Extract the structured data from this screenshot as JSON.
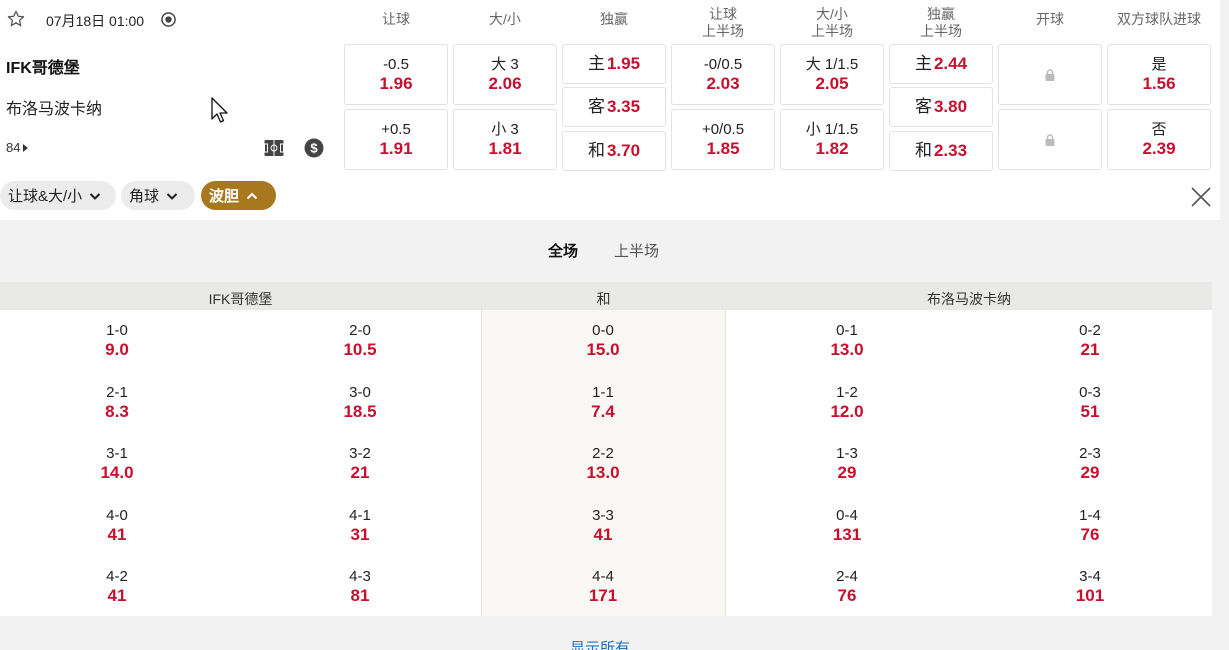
{
  "match": {
    "time": "07月18日 01:00",
    "home_team": "IFK哥德堡",
    "away_team": "布洛马波卡纳",
    "more_markets": "84"
  },
  "columns": [
    "让球",
    "大/小",
    "独赢",
    "让球\n上半场",
    "大/小\n上半场",
    "独赢\n上半场",
    "开球",
    "双方球队进球"
  ],
  "markets": {
    "handicap": [
      {
        "line": "-0.5",
        "odds": "1.96"
      },
      {
        "line": "+0.5",
        "odds": "1.91"
      }
    ],
    "over_under": [
      {
        "line": "大 3",
        "odds": "2.06"
      },
      {
        "line": "小 3",
        "odds": "1.81"
      }
    ],
    "moneyline": [
      {
        "label": "主",
        "odds": "1.95"
      },
      {
        "label": "客",
        "odds": "3.35"
      },
      {
        "label": "和",
        "odds": "3.70"
      }
    ],
    "handicap_1h": [
      {
        "line": "-0/0.5",
        "odds": "2.03"
      },
      {
        "line": "+0/0.5",
        "odds": "1.85"
      }
    ],
    "over_under_1h": [
      {
        "line": "大 1/1.5",
        "odds": "2.05"
      },
      {
        "line": "小 1/1.5",
        "odds": "1.82"
      }
    ],
    "moneyline_1h": [
      {
        "label": "主",
        "odds": "2.44"
      },
      {
        "label": "客",
        "odds": "3.80"
      },
      {
        "label": "和",
        "odds": "2.33"
      }
    ],
    "btts": [
      {
        "label": "是",
        "odds": "1.56"
      },
      {
        "label": "否",
        "odds": "2.39"
      }
    ]
  },
  "filters": [
    {
      "label": "让球&大/小",
      "active": false
    },
    {
      "label": "角球",
      "active": false
    },
    {
      "label": "波胆",
      "active": true
    }
  ],
  "period_tabs": [
    {
      "label": "全场",
      "active": true
    },
    {
      "label": "上半场",
      "active": false
    }
  ],
  "correct_score": {
    "headers": {
      "home": "IFK哥德堡",
      "draw": "和",
      "away": "布洛马波卡纳"
    },
    "home_col1": [
      [
        "1-0",
        "9.0"
      ],
      [
        "2-1",
        "8.3"
      ],
      [
        "3-1",
        "14.0"
      ],
      [
        "4-0",
        "41"
      ],
      [
        "4-2",
        "41"
      ]
    ],
    "home_col2": [
      [
        "2-0",
        "10.5"
      ],
      [
        "3-0",
        "18.5"
      ],
      [
        "3-2",
        "21"
      ],
      [
        "4-1",
        "31"
      ],
      [
        "4-3",
        "81"
      ]
    ],
    "draw": [
      [
        "0-0",
        "15.0"
      ],
      [
        "1-1",
        "7.4"
      ],
      [
        "2-2",
        "13.0"
      ],
      [
        "3-3",
        "41"
      ],
      [
        "4-4",
        "171"
      ]
    ],
    "away_col1": [
      [
        "0-1",
        "13.0"
      ],
      [
        "1-2",
        "12.0"
      ],
      [
        "1-3",
        "29"
      ],
      [
        "0-4",
        "131"
      ],
      [
        "2-4",
        "76"
      ]
    ],
    "away_col2": [
      [
        "0-2",
        "21"
      ],
      [
        "0-3",
        "51"
      ],
      [
        "2-3",
        "29"
      ],
      [
        "1-4",
        "76"
      ],
      [
        "3-4",
        "101"
      ]
    ]
  },
  "show_all": "显示所有",
  "colors": {
    "odds_red": "#c8102e",
    "active_pill": "#a8781f",
    "link_blue": "#1e6fc4"
  }
}
